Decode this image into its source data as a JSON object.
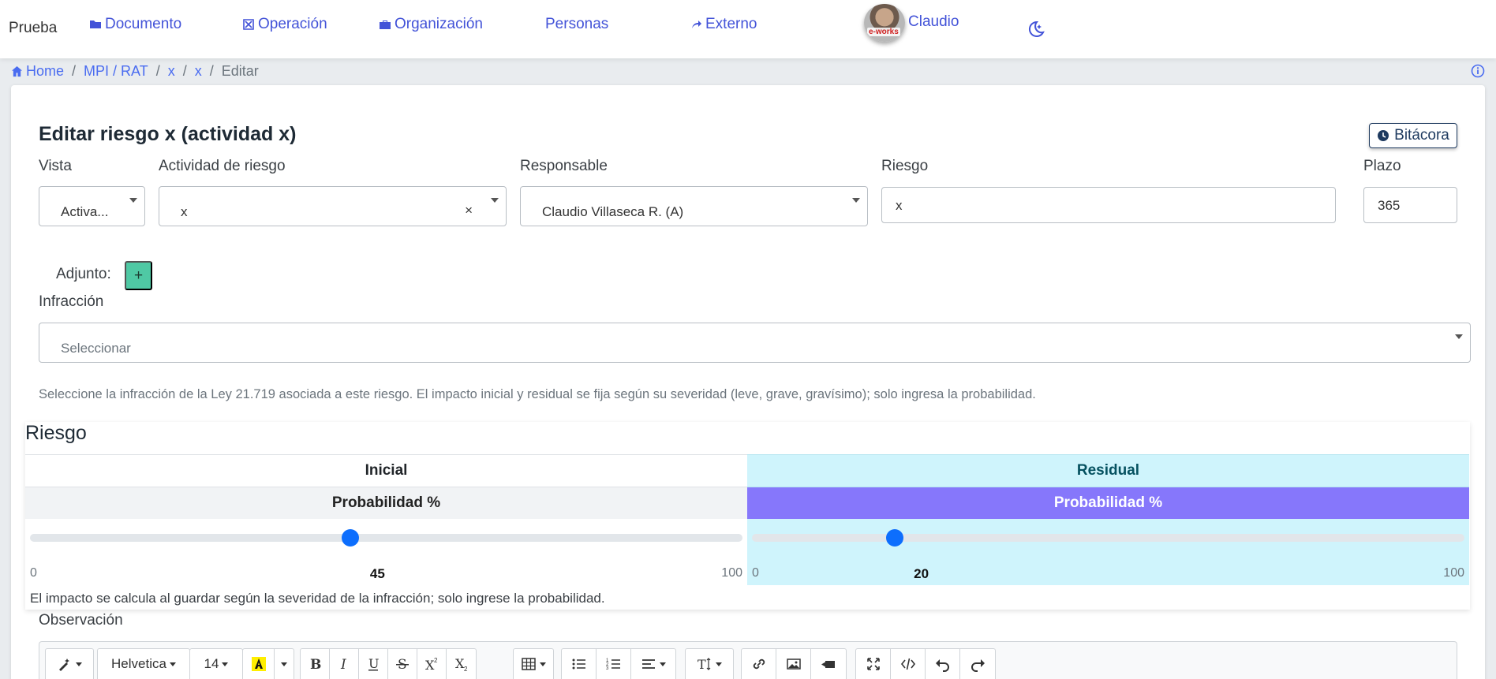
{
  "navbar": {
    "brand": "Prueba",
    "items": [
      {
        "label": "Documento",
        "icon": "folder-icon"
      },
      {
        "label": "Operación",
        "icon": "cube-icon"
      },
      {
        "label": "Organización",
        "icon": "briefcase-icon"
      },
      {
        "label": "Personas",
        "icon": ""
      },
      {
        "label": "Externo",
        "icon": "share-arrow-icon"
      }
    ],
    "user": {
      "name": "Claudio",
      "avatar_badge": "e-works"
    }
  },
  "breadcrumb": {
    "items": [
      "Home",
      "MPI / RAT",
      "x",
      "x",
      "Editar"
    ]
  },
  "form": {
    "title": "Editar riesgo x (actividad x)",
    "bitacora_label": "Bitácora",
    "vista": {
      "label": "Vista",
      "value": "Activa..."
    },
    "actividad": {
      "label": "Actividad de riesgo",
      "value": "x",
      "clear": "×"
    },
    "responsable": {
      "label": "Responsable",
      "value": "Claudio Villaseca R. (A)"
    },
    "riesgo": {
      "label": "Riesgo",
      "value": "x"
    },
    "plazo": {
      "label": "Plazo",
      "value": "365"
    },
    "adjunto": {
      "label": "Adjunto:",
      "add_label": "+"
    },
    "infraccion": {
      "label": "Infracción",
      "placeholder": "Seleccionar",
      "help": "Seleccione la infracción de la Ley 21.719 asociada a este riesgo. El impacto inicial y residual se fija según su severidad (leve, grave, gravísimo); solo ingresa la probabilidad."
    }
  },
  "risk": {
    "title": "Riesgo",
    "initial": {
      "heading": "Inicial",
      "prob_label": "Probabilidad %",
      "min": "0",
      "max": "100",
      "value": 45
    },
    "residual": {
      "heading": "Residual",
      "prob_label": "Probabilidad %",
      "min": "0",
      "max": "100",
      "value": 20
    },
    "footnote": "El impacto se calcula al guardar según la severidad de la infracción; solo ingrese la probabilidad."
  },
  "observacion": {
    "label": "Observación",
    "toolbar": {
      "font_name": "Helvetica",
      "font_size": "14"
    }
  },
  "colors": {
    "accent": "#4353d8",
    "residual_bg": "#cff4fc",
    "residual_prob": "#8677fb",
    "slider_thumb": "#0d6efd",
    "add_button": "#4fc9a4"
  }
}
